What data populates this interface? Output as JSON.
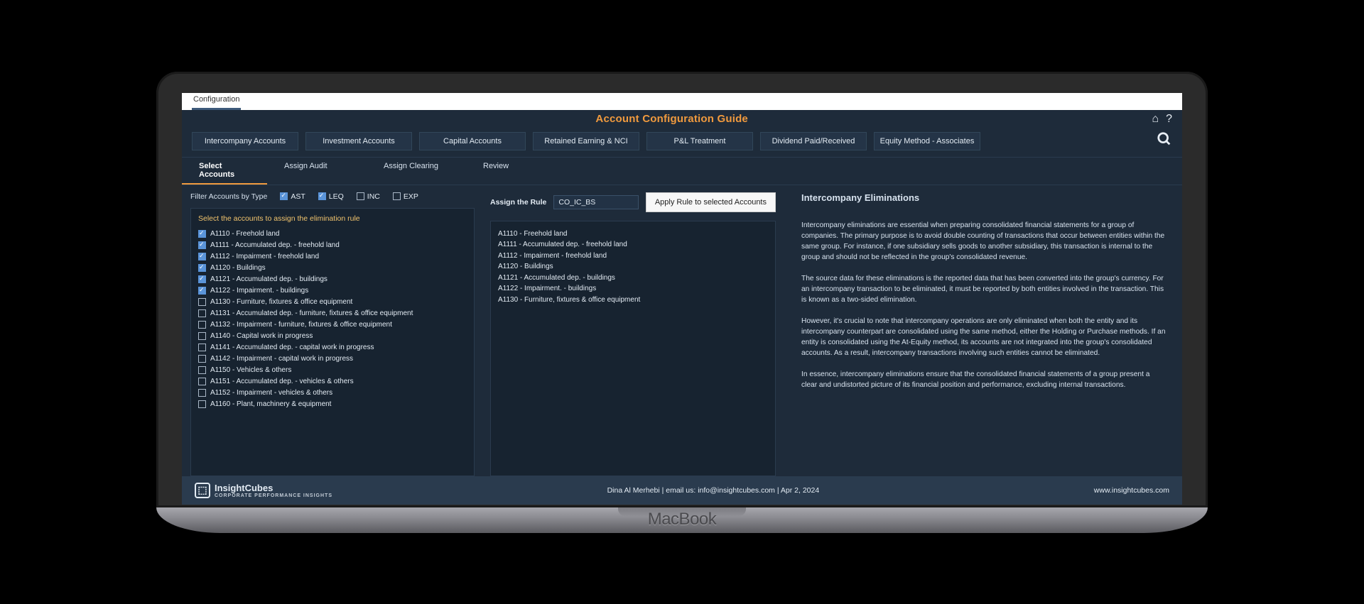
{
  "topbar": {
    "tab": "Configuration"
  },
  "title": "Account Configuration Guide",
  "mainTabs": [
    "Intercompany Accounts",
    "Investment Accounts",
    "Capital Accounts",
    "Retained Earning & NCI",
    "P&L Treatment",
    "Dividend Paid/Received",
    "Equity Method - Associates"
  ],
  "subTabs": [
    "Select Accounts",
    "Assign Audit",
    "Assign Clearing",
    "Review"
  ],
  "activeSubTab": 0,
  "filter": {
    "label": "Filter Accounts by Type",
    "types": [
      {
        "code": "AST",
        "checked": true
      },
      {
        "code": "LEQ",
        "checked": true
      },
      {
        "code": "INC",
        "checked": false
      },
      {
        "code": "EXP",
        "checked": false
      }
    ]
  },
  "accountPanel": {
    "header": "Select the accounts to assign the elimination rule",
    "rows": [
      {
        "label": "A1110 - Freehold land",
        "sel": true
      },
      {
        "label": "A1111 - Accumulated dep. - freehold land",
        "sel": true
      },
      {
        "label": "A1112 - Impairment - freehold land",
        "sel": true
      },
      {
        "label": "A1120 - Buildings",
        "sel": true
      },
      {
        "label": "A1121 - Accumulated dep. - buildings",
        "sel": true
      },
      {
        "label": "A1122 - Impairment. - buildings",
        "sel": true
      },
      {
        "label": "A1130 - Furniture, fixtures & office equipment",
        "sel": false
      },
      {
        "label": "A1131 - Accumulated dep. - furniture, fixtures & office equipment",
        "sel": false
      },
      {
        "label": "A1132 - Impairment - furniture, fixtures & office equipment",
        "sel": false
      },
      {
        "label": "A1140 - Capital work in progress",
        "sel": false
      },
      {
        "label": "A1141 - Accumulated dep. - capital work in progress",
        "sel": false
      },
      {
        "label": "A1142 - Impairment - capital work in progress",
        "sel": false
      },
      {
        "label": "A1150 - Vehicles & others",
        "sel": false
      },
      {
        "label": "A1151 - Accumulated dep. - vehicles & others",
        "sel": false
      },
      {
        "label": "A1152 - Impairment - vehicles & others",
        "sel": false
      },
      {
        "label": "A1160 - Plant, machinery & equipment",
        "sel": false
      }
    ]
  },
  "assign": {
    "label": "Assign the Rule",
    "value": "CO_IC_BS",
    "button": "Apply Rule to selected Accounts"
  },
  "selectedList": [
    "A1110 - Freehold land",
    "A1111 - Accumulated dep. - freehold land",
    "A1112 - Impairment - freehold land",
    "A1120 - Buildings",
    "A1121 - Accumulated dep. - buildings",
    "A1122 - Impairment. - buildings",
    "A1130 - Furniture, fixtures & office equipment"
  ],
  "info": {
    "title": "Intercompany Eliminations",
    "paras": [
      "Intercompany eliminations are essential when preparing consolidated financial statements for a group of companies. The primary purpose is to avoid double counting of transactions that occur between entities within the same group. For instance, if one subsidiary sells goods to another subsidiary, this transaction is internal to the group and should not be reflected in the group's consolidated revenue.",
      "The source data for these eliminations is the reported data that has been converted into the group's currency. For an intercompany transaction to be eliminated, it must be reported by both entities involved in the transaction. This is known as a two-sided elimination.",
      "However, it's crucial to note that intercompany operations are only eliminated when both the entity and its intercompany counterpart are consolidated using the same method, either the Holding or Purchase methods. If an entity is consolidated using the At-Equity method, its accounts are not integrated into the group's consolidated accounts. As a result, intercompany transactions involving such entities cannot be eliminated.",
      "In essence, intercompany eliminations ensure that the consolidated financial statements of a group present a clear and undistorted picture of its financial position and performance, excluding internal transactions."
    ]
  },
  "footer": {
    "brand": "InsightCubes",
    "brandSub": "CORPORATE PERFORMANCE INSIGHTS",
    "mid": "Dina Al Merhebi | email us: info@insightcubes.com | Apr 2, 2024",
    "right": "www.insightcubes.com"
  },
  "macbook": "MacBook"
}
